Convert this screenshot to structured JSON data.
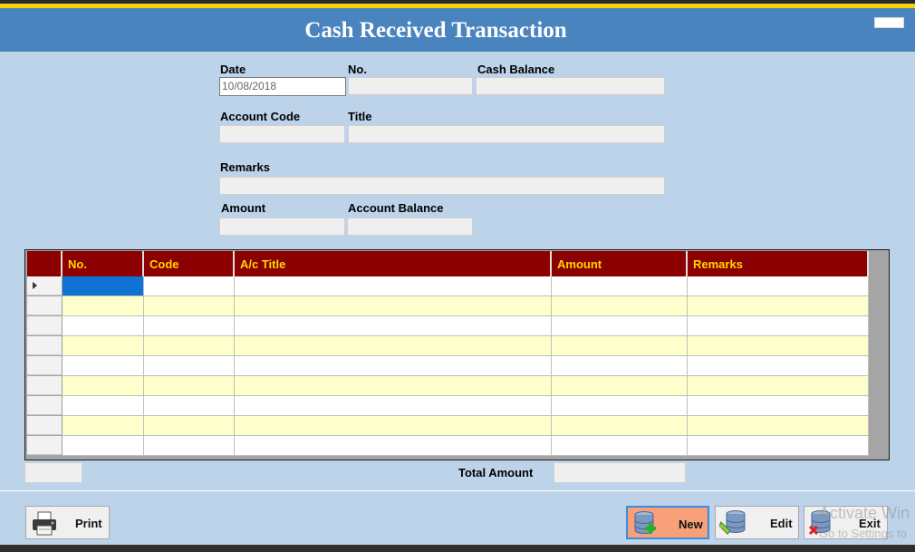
{
  "window": {
    "title": "Cash Received Transaction"
  },
  "form": {
    "date_label": "Date",
    "date_value": "10/08/2018",
    "no_label": "No.",
    "cash_balance_label": "Cash Balance",
    "account_code_label": "Account Code",
    "title_label": "Title",
    "remarks_label": "Remarks",
    "amount_label": "Amount",
    "account_balance_label": "Account Balance"
  },
  "grid": {
    "columns": [
      "No.",
      "Code",
      "A/c Title",
      "Amount",
      "Remarks"
    ],
    "row_count": 9,
    "colors": {
      "header_bg": "#8b0000",
      "header_text": "#ffd700",
      "alt_row": "#ffffcc",
      "selected": "#0f73d6"
    }
  },
  "totals": {
    "total_amount_label": "Total Amount"
  },
  "buttons": {
    "print": "Print",
    "new": "New",
    "edit": "Edit",
    "exit": "Exit"
  },
  "watermark": {
    "line1": "Activate Win",
    "line2": "Go to Settings to"
  }
}
